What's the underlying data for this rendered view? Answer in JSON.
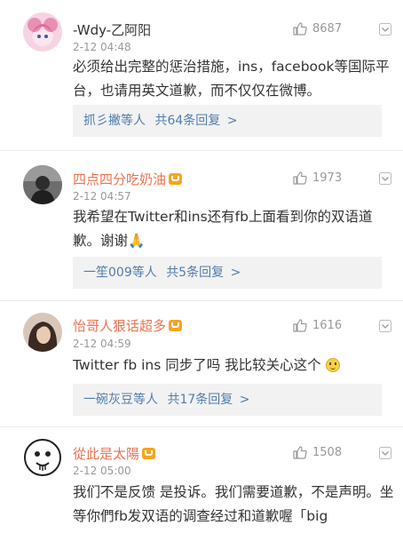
{
  "comments": [
    {
      "name": "-Wdy-乙阿阳",
      "vip": false,
      "time": "2-12 04:48",
      "likes": "8687",
      "text": "必须给出完整的惩治措施，ins，facebook等国际平台，也请用英文道歉，而不仅仅在微博。",
      "replies": {
        "users": "抓彡撇等人",
        "count": "共64条回复",
        "arrow": ">"
      }
    },
    {
      "name": "四点四分吃奶油",
      "vip": true,
      "time": "2-12 04:57",
      "likes": "1973",
      "text": "我希望在Twitter和ins还有fb上面看到你的双语道歉。谢谢",
      "emoji": "🙏",
      "replies": {
        "users": "一笙009等人",
        "count": "共5条回复",
        "arrow": ">"
      }
    },
    {
      "name": "怡哥人狠话超多",
      "vip": true,
      "time": "2-12 04:59",
      "likes": "1616",
      "text": "Twitter fb ins 同步了吗 我比较关心这个",
      "emoji": "smile",
      "replies": {
        "users": "一碗灰豆等人",
        "count": "共17条回复",
        "arrow": ">"
      }
    },
    {
      "name": "從此是太陽",
      "vip": true,
      "time": "2-12 05:00",
      "likes": "1508",
      "text": "我们不是反馈 是投诉。我们需要道歉，不是声明。坐等你們fb发双语的调查经过和道歉喔「big"
    }
  ],
  "icons": {
    "like": "thumbs-up-icon",
    "more": "chevron-down-icon",
    "vip": "vip-crown-icon"
  }
}
